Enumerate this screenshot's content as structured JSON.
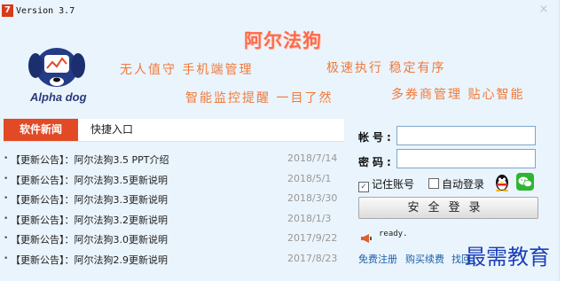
{
  "window": {
    "icon_char": "7",
    "title": "Version 3.7",
    "close_glyph": "×"
  },
  "brand": {
    "name": "阿尔法狗",
    "logo_text": "Alpha dog",
    "slogans": [
      "无人值守 手机端管理",
      "极速执行 稳定有序",
      "智能监控提醒 一目了然",
      "多券商管理 贴心智能"
    ]
  },
  "news": {
    "tabs": [
      {
        "label": "软件新闻",
        "active": true
      },
      {
        "label": "快捷入口",
        "active": false
      }
    ],
    "items": [
      {
        "text": "【更新公告】：阿尔法狗3.5 PPT介绍",
        "date": "2018/7/14"
      },
      {
        "text": "【更新公告】：阿尔法狗3.5更新说明",
        "date": "2018/5/1"
      },
      {
        "text": "【更新公告】：阿尔法狗3.3更新说明",
        "date": "2018/3/30"
      },
      {
        "text": "【更新公告】：阿尔法狗3.2更新说明",
        "date": "2018/1/3"
      },
      {
        "text": "【更新公告】：阿尔法狗3.0更新说明",
        "date": "2017/9/22"
      },
      {
        "text": "【更新公告】：阿尔法狗2.9更新说明",
        "date": "2017/8/23"
      }
    ]
  },
  "login": {
    "account_label": "帐号:",
    "account_value": "",
    "password_label": "密码:",
    "password_value": "",
    "remember_label": "记住账号",
    "remember_checked": true,
    "remember_mark": "✓",
    "autologin_label": "自动登录",
    "autologin_checked": false,
    "login_button": "安全登录",
    "status_text": "ready.",
    "links": [
      "免费注册",
      "购买续费",
      "找回"
    ]
  },
  "watermark": "最需教育",
  "colors": {
    "accent": "#e24a26",
    "brand_title": "#ff6a4a",
    "slogan": "#f07a3a",
    "link": "#1d5fa8",
    "window_bg": "#eaf4fc"
  },
  "icons": [
    "app-icon",
    "close-icon",
    "alpha-dog-logo",
    "bullet-icon",
    "qq-penguin-icon",
    "wechat-icon",
    "megaphone-icon"
  ]
}
